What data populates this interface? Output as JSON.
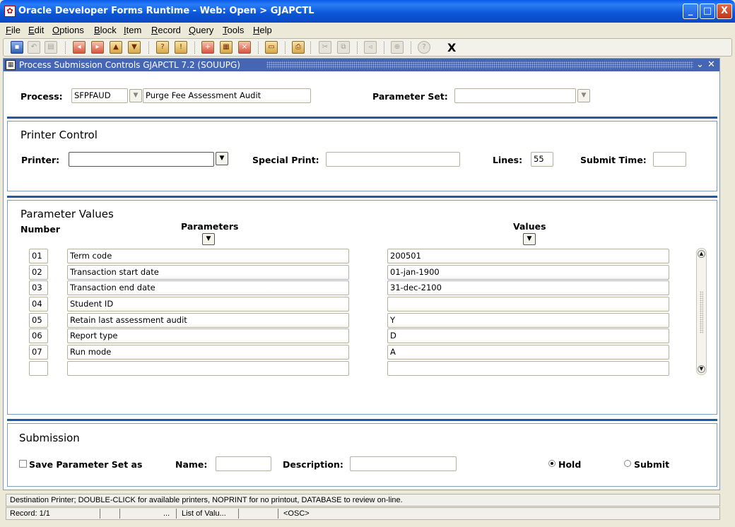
{
  "window": {
    "title": "Oracle Developer Forms Runtime - Web:  Open > GJAPCTL",
    "min_label": "_",
    "max_label": "□",
    "close_label": "X"
  },
  "menu": [
    "File",
    "Edit",
    "Options",
    "Block",
    "Item",
    "Record",
    "Query",
    "Tools",
    "Help"
  ],
  "toolbar": {
    "exit_label": "X"
  },
  "form": {
    "title": "Process Submission Controls  GJAPCTL  7.2  (SOUUPG)",
    "title_controls": [
      "⌄",
      "✕"
    ]
  },
  "process": {
    "label": "Process:",
    "code": "SFPFAUD",
    "description": "Purge Fee Assessment Audit",
    "parameter_set_label": "Parameter Set:",
    "parameter_set_value": ""
  },
  "printer_control": {
    "title": "Printer Control",
    "printer_label": "Printer:",
    "printer_value": "",
    "special_print_label": "Special Print:",
    "special_print_value": "",
    "lines_label": "Lines:",
    "lines_value": "55",
    "submit_time_label": "Submit Time:",
    "submit_time_value": ""
  },
  "parameter_values": {
    "title": "Parameter Values",
    "number_header": "Number",
    "parameters_header": "Parameters",
    "values_header": "Values",
    "rows": [
      {
        "number": "01",
        "parameter": "Term code",
        "value": "200501"
      },
      {
        "number": "02",
        "parameter": "Transaction start date",
        "value": "01-jan-1900"
      },
      {
        "number": "03",
        "parameter": "Transaction end date",
        "value": "31-dec-2100"
      },
      {
        "number": "04",
        "parameter": "Student ID",
        "value": ""
      },
      {
        "number": "05",
        "parameter": "Retain last assessment audit",
        "value": "Y"
      },
      {
        "number": "06",
        "parameter": "Report type",
        "value": "D"
      },
      {
        "number": "07",
        "parameter": "Run mode",
        "value": "A"
      },
      {
        "number": "",
        "parameter": "",
        "value": ""
      }
    ]
  },
  "submission": {
    "title": "Submission",
    "save_set_label": "Save Parameter Set as",
    "save_set_checked": false,
    "name_label": "Name:",
    "name_value": "",
    "description_label": "Description:",
    "description_value": "",
    "hold_label": "Hold",
    "submit_label": "Submit",
    "selected": "Hold"
  },
  "status": {
    "hint": "Destination Printer; DOUBLE-CLICK for available printers, NOPRINT for no printout, DATABASE to review on-line.",
    "record": "Record: 1/1",
    "ellipsis": "...",
    "list_of_values": "List of Valu...",
    "osc": "<OSC>"
  }
}
